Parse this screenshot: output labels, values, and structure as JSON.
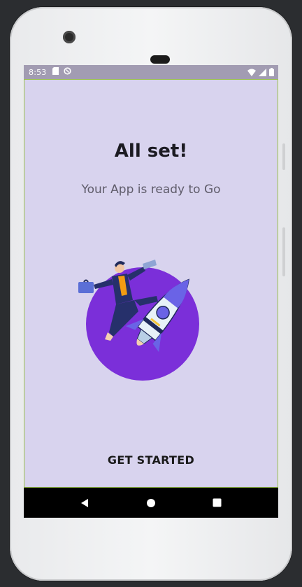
{
  "status_bar": {
    "time": "8:53",
    "left_icons": [
      "sd-card-icon",
      "sync-icon"
    ],
    "right_icons": [
      "wifi-icon",
      "signal-icon",
      "battery-icon"
    ]
  },
  "onboarding": {
    "title": "All set!",
    "subtitle": "Your App is ready to Go",
    "illustration": "businessman-on-rocket",
    "cta_label": "GET STARTED"
  },
  "nav_bar": {
    "buttons": [
      "back-icon",
      "home-icon",
      "recents-icon"
    ]
  },
  "colors": {
    "background": "#d8d3ee",
    "status_bar": "#a29cb2",
    "circle": "#7b2fd9",
    "rocket": "#6a63e6"
  }
}
